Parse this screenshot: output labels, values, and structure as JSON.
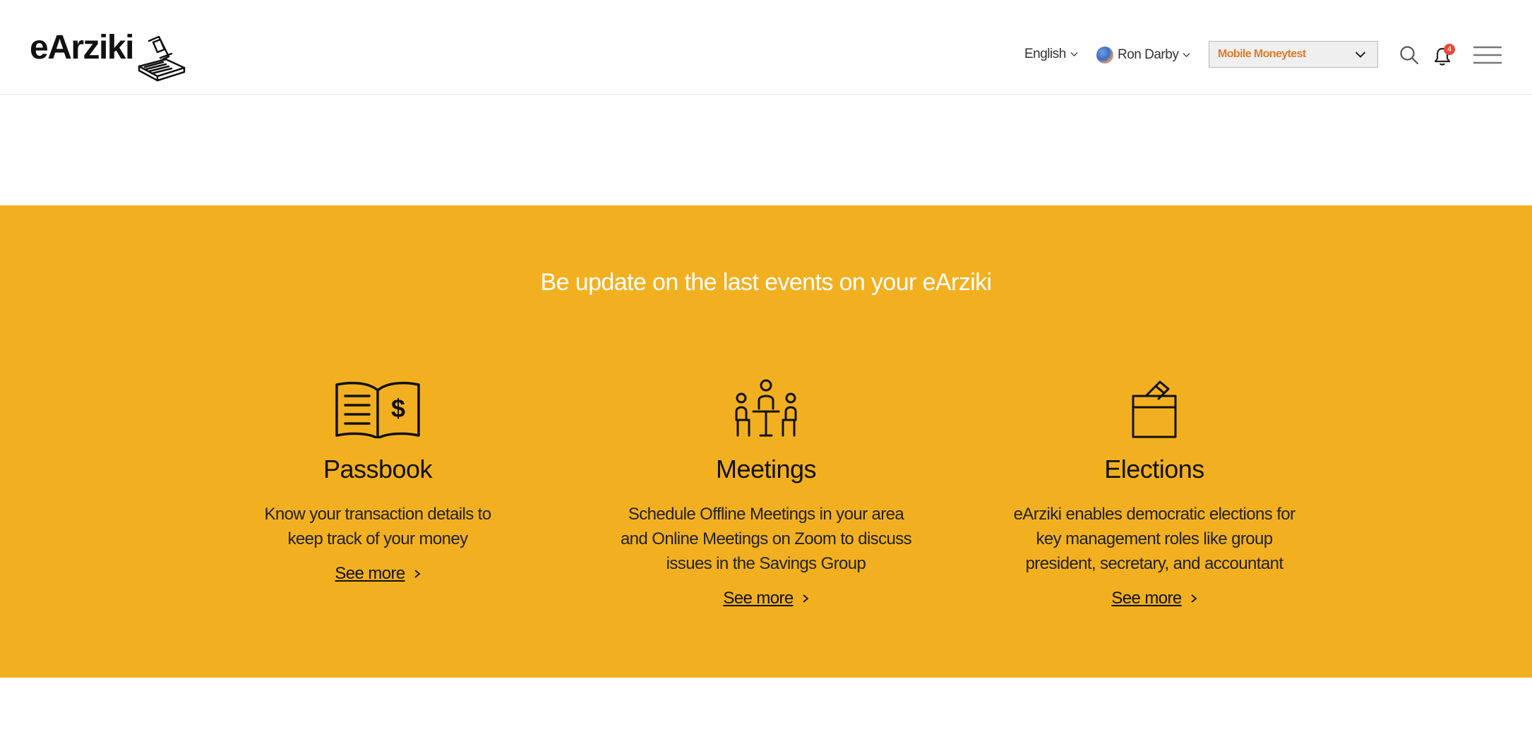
{
  "header": {
    "logo_text": "eArziki",
    "language": "English",
    "user_name": "Ron Darby",
    "group_select_value": "Mobile Moneytest",
    "notification_count": "4"
  },
  "band": {
    "title": "Be update on the last events on your eArziki",
    "features": [
      {
        "icon": "passbook-icon",
        "title": "Passbook",
        "description": "Know your transaction details to keep track of your money",
        "link": "See more"
      },
      {
        "icon": "meetings-icon",
        "title": "Meetings",
        "description": "Schedule Offline Meetings in your area and Online Meetings on Zoom to discuss issues in the Savings Group",
        "link": "See more"
      },
      {
        "icon": "ballot-box-icon",
        "title": "Elections",
        "description": "eArziki enables democratic elections for key management roles like group president, secretary, and accountant",
        "link": "See more"
      }
    ]
  },
  "colors": {
    "band_background": "#f2b021",
    "select_text": "#e07b2a",
    "badge": "#e8483a"
  }
}
